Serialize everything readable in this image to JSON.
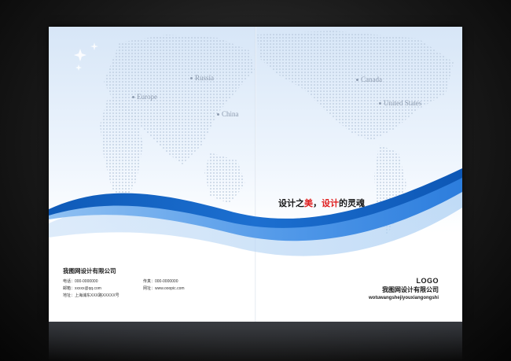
{
  "map_labels": {
    "russia": "Russia",
    "europe": "Europe",
    "china": "China",
    "canada": "Canada",
    "united_states": "United States"
  },
  "slogan": {
    "part1": "设计之",
    "part2": "美",
    "part3": "，",
    "part4": "设计",
    "part5": "的灵魂"
  },
  "company_left": {
    "name": "我图网设计有限公司",
    "phone": "电话：000-0000000",
    "fax": "传真：000-0000000",
    "email": "邮箱：xxxxx@qq.com",
    "website": "网址：www.ooopic.com",
    "address": "地址：上海浦东XXX路XXXXX号"
  },
  "logo_block": {
    "logo": "LOGO",
    "company": "我图网设计有限公司",
    "pinyin": "wotuwangshejiyouxiangongshi"
  },
  "colors": {
    "wave_dark": "#1565c8",
    "wave_light": "#5aa2ee",
    "accent_red": "#e02020",
    "background": "#1a1a1a"
  }
}
